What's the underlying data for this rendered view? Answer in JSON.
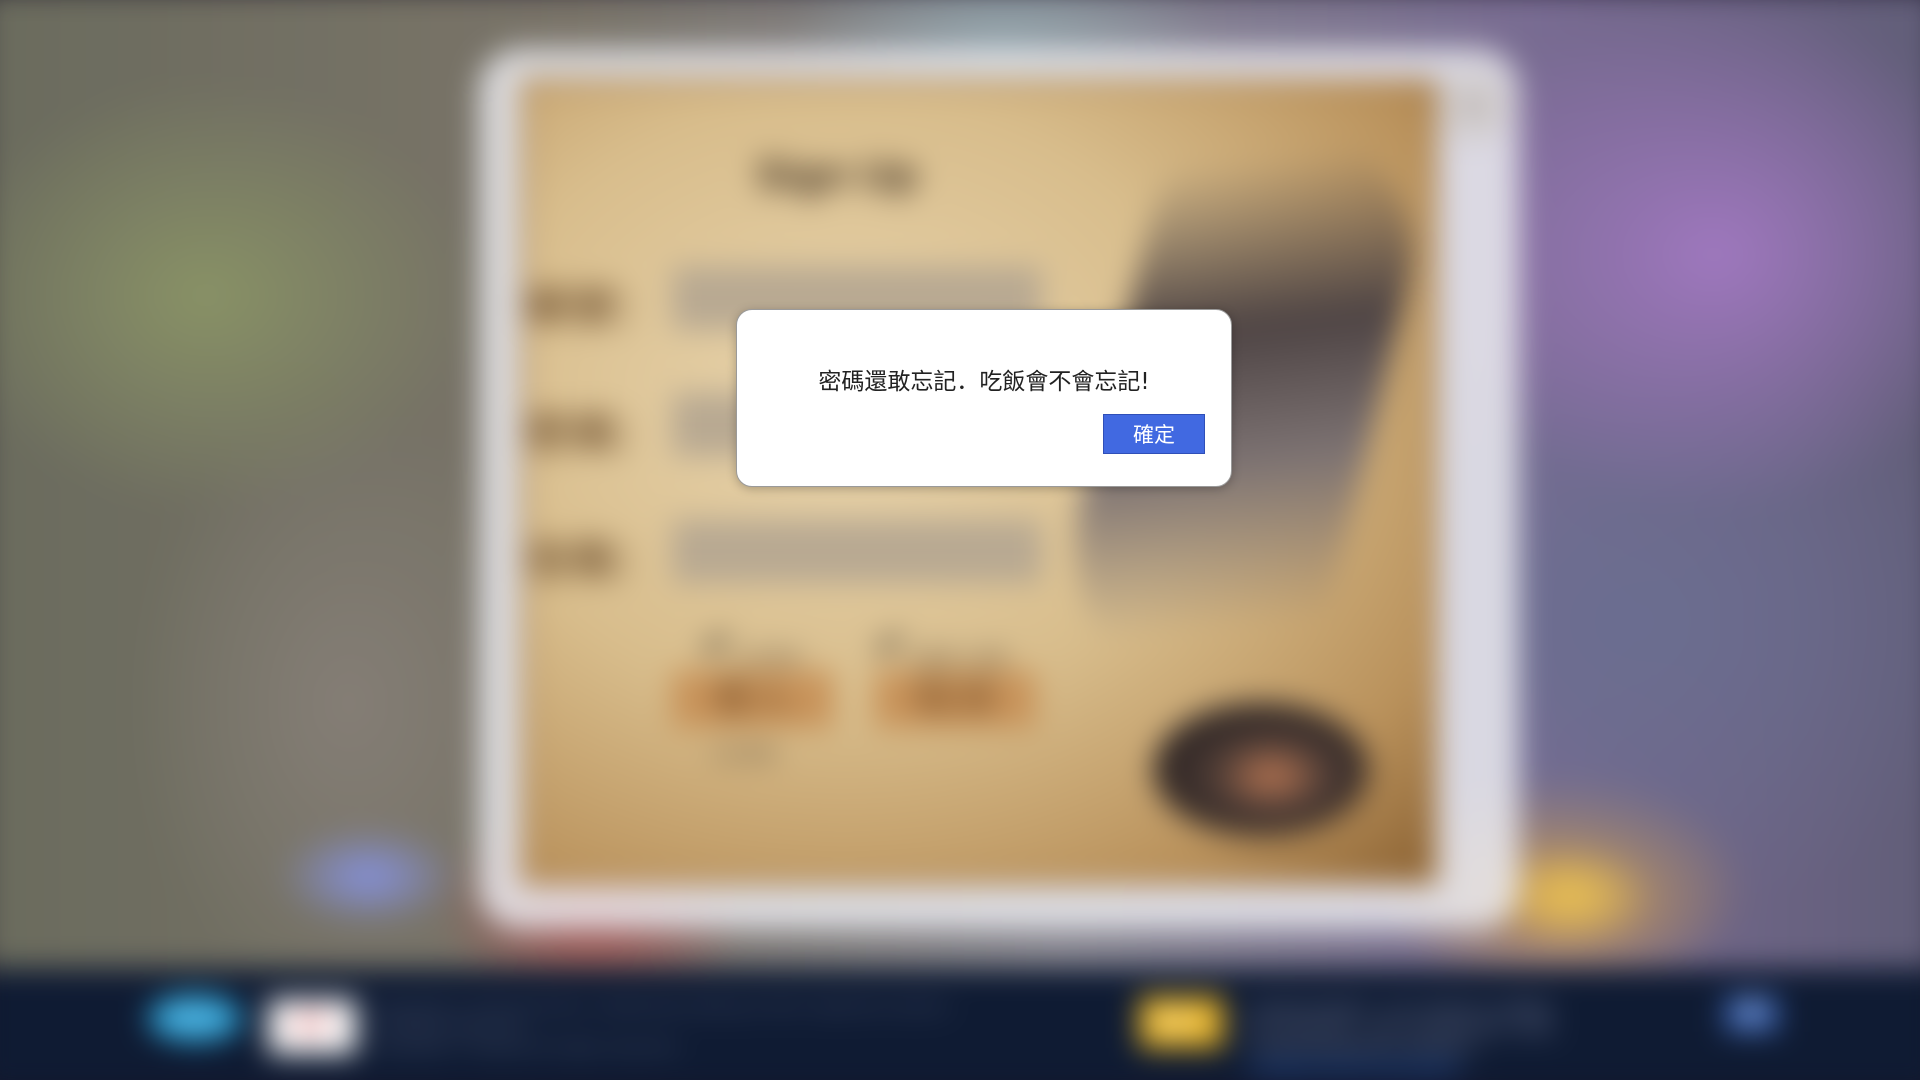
{
  "signup_panel": {
    "title": "Sign Up",
    "fields": [
      {
        "label": "帳號："
      },
      {
        "label": "密碼："
      },
      {
        "label": "信箱："
      }
    ],
    "checkboxes": [
      {
        "label": "記住帳號"
      },
      {
        "label": "自動登入遊戲"
      }
    ],
    "login_button": "登入",
    "cancel_button": "取消",
    "forgot_link": "忘記密碼"
  },
  "alert": {
    "message": "密碼還敢忘記．吃飯會不會忘記!",
    "confirm_label": "確定"
  },
  "footer": {
    "logo_1": "Yahoo",
    "logo_2": "F7",
    "copyright_lines": [
      "Copyright © Gaming Online. Trademarks belong to their respective owners.",
      "All Rights Reserved.",
      "Copyright © Yakuaki All rights reserved."
    ],
    "rating": "12+",
    "notice_lines": [
      "本遊戲為免費遊戲，部分內容需另行付費購買。",
      "請注意遊戲時間，避免沉迷遊戲影響身心健康。",
      "本遊戲依據遊戲軟體分級管理辦法。"
    ],
    "notice_link": "本遊戲使用者條款及隱私權政策"
  },
  "colors": {
    "alert_button": "#4169e1",
    "footer_bg": "#0f1b33",
    "parchment": "#d8bd8c"
  },
  "icons": {
    "close": "close-icon",
    "check": "check-icon",
    "facebook": "facebook-icon"
  }
}
